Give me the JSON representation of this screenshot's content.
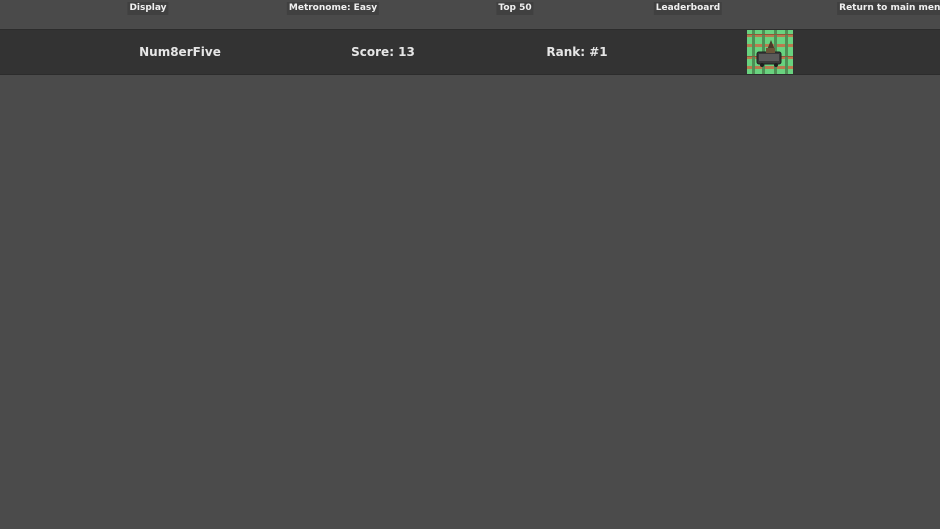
{
  "nav": {
    "display_label": "Display",
    "metronome_label": "Metronome: Easy",
    "top50_label": "Top 50",
    "leaderboard_label": "Leaderboard",
    "return_label": "Return to main menu"
  },
  "leaderboard_row": {
    "name": "Num8erFive",
    "score": "Score: 13",
    "rank": "Rank: #1",
    "thumbnail_icon": "minecart-track-thumbnail-icon"
  },
  "colors": {
    "background": "#4b4b4b",
    "row_background": "#333333",
    "button_background": "#404040",
    "grass": "#69d27f",
    "track": "#b97a4f",
    "cart": "#3a3a3a"
  }
}
